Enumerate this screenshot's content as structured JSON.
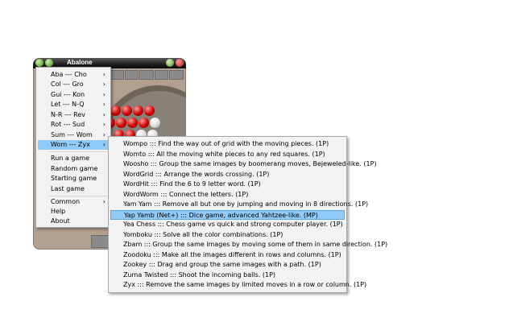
{
  "window": {
    "title": "Abalone"
  },
  "main_menu": {
    "items": [
      {
        "label": "Aba --- Cho",
        "arrow": "›"
      },
      {
        "label": "Col --- Gro",
        "arrow": "›"
      },
      {
        "label": "Gui --- Kon",
        "arrow": "›"
      },
      {
        "label": "Let --- N-Q",
        "arrow": "›"
      },
      {
        "label": "N-R --- Rev",
        "arrow": "›"
      },
      {
        "label": "Rot --- Sud",
        "arrow": "›"
      },
      {
        "label": "Sum --- Wom",
        "arrow": "›"
      },
      {
        "label": "Wom --- Zyx",
        "arrow": "›"
      }
    ],
    "actions": [
      "Run a game",
      "Random game",
      "Starting game",
      "Last game"
    ],
    "common": {
      "label": "Common",
      "arrow": "›"
    },
    "help": "Help",
    "about": "About"
  },
  "sub_menu": {
    "items": [
      "Wompo ::: Find the way out of grid with the moving pieces. (1P)",
      "Womto ::: All the moving white pieces to any red squares. (1P)",
      "Woosho ::: Group the same images by boomerang moves, Bejeweled-like. (1P)",
      "WordGrid ::: Arrange the words crossing. (1P)",
      "WordHit ::: Find the 6 to 9 letter word. (1P)",
      "WordWorm ::: Connect the letters. (1P)",
      "Yam Yam ::: Remove all but one by jumping and moving in 8 directions. (1P)",
      "Yap Yamb (Net+) ::: Dice game, advanced Yahtzee-like. (MP)",
      "Yea Chess ::: Chess game vs quick and strong computer player. (1P)",
      "Yomboku ::: Solve all the color combinations. (1P)",
      "Zbam ::: Group the same images by moving some of them in same direction. (1P)",
      "Zoodoku ::: Make all the images different in rows and columns. (1P)",
      "Zookey ::: Drag and group the same images with a path. (1P)",
      "Zuma Twisted ::: Shoot the incoming balls. (1P)",
      "Zyx ::: Remove the same images by limited moves in a row or column. (1P)"
    ]
  }
}
